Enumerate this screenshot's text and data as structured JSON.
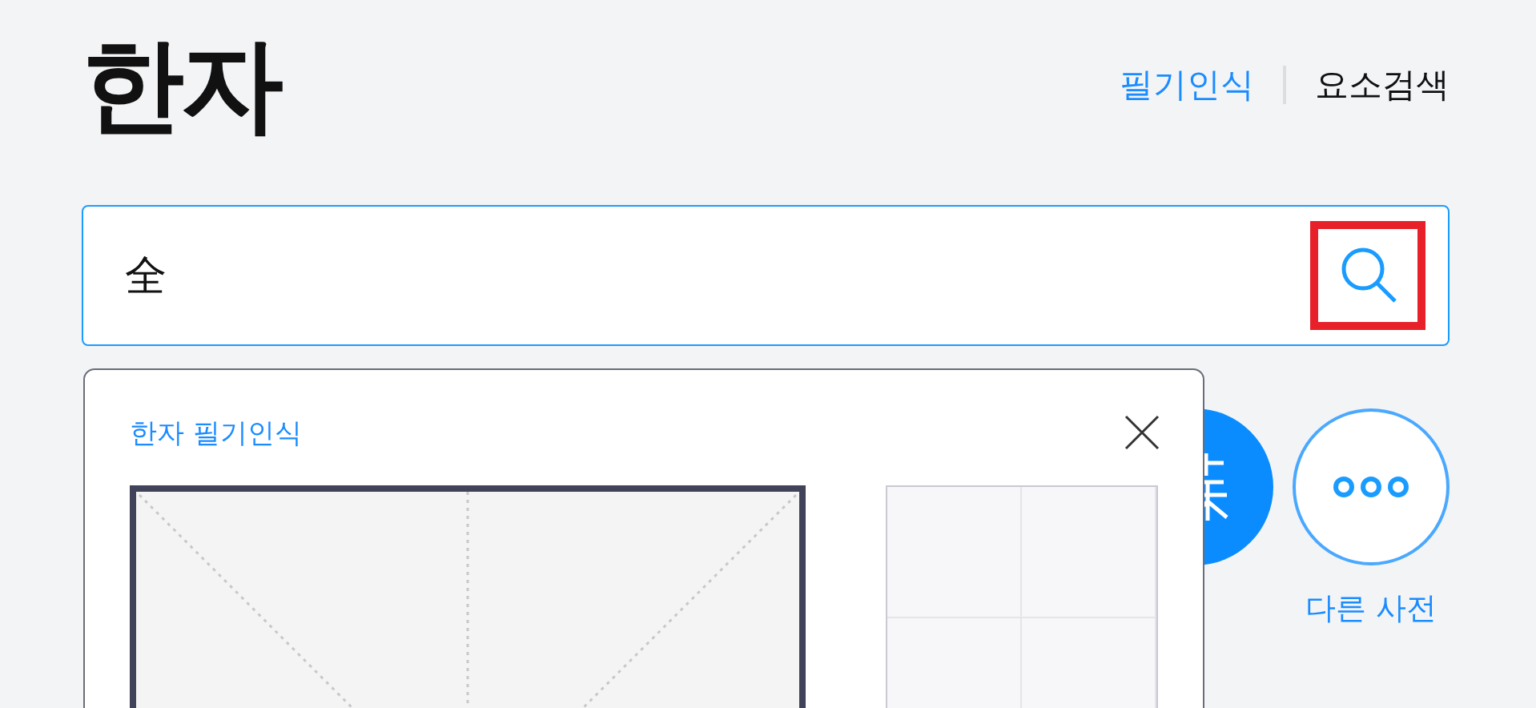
{
  "title": "한자",
  "header_links": [
    {
      "label": "필기인식",
      "selected": true
    },
    {
      "label": "요소검색",
      "selected": false
    }
  ],
  "search": {
    "value": "全"
  },
  "side_buttons": [
    {
      "kind": "hanja"
    },
    {
      "kind": "more",
      "label": "다른 사전"
    }
  ],
  "handwriting_popup": {
    "title": "한자 필기인식"
  }
}
